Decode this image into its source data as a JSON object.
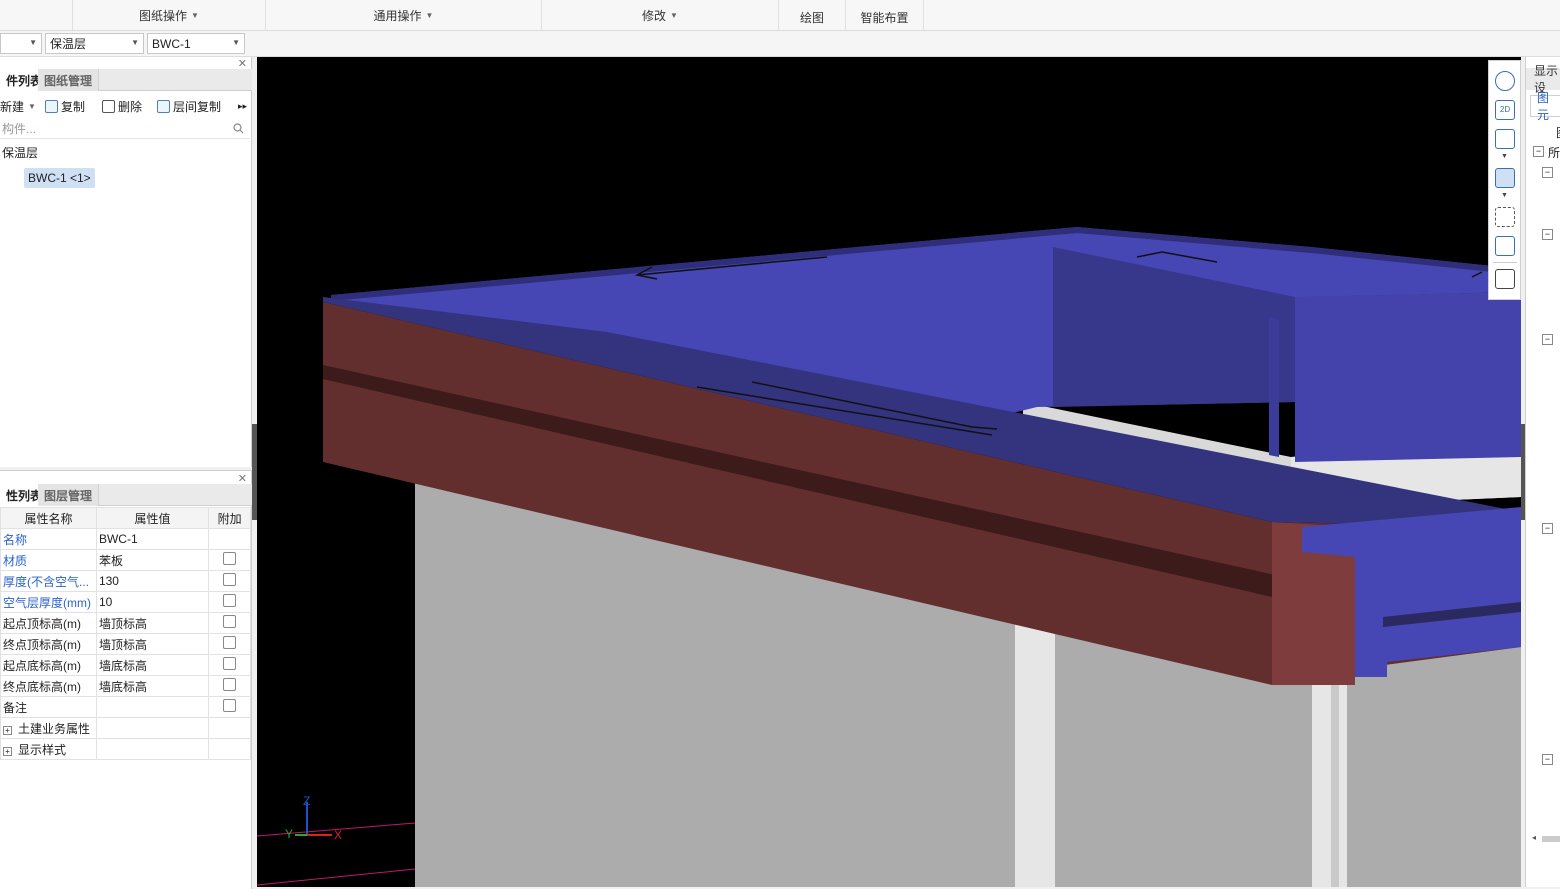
{
  "ribbon": {
    "groups": [
      "图纸操作",
      "通用操作",
      "修改",
      "绘图",
      "智能布置"
    ]
  },
  "selector": {
    "floor": "",
    "type": "保温层",
    "component": "BWC-1"
  },
  "component_list": {
    "tab_active": "件列表",
    "tab_other": "图纸管理",
    "toolbar": {
      "new": "新建",
      "copy": "复制",
      "delete": "删除",
      "floor_copy": "层间复制"
    },
    "search_placeholder": "构件...",
    "tree": {
      "category": "保温层",
      "item": "BWC-1 <1>"
    }
  },
  "property_list": {
    "tab_active": "性列表",
    "tab_other": "图层管理",
    "headers": [
      "属性名称",
      "属性值",
      "附加"
    ],
    "rows": [
      {
        "name": "名称",
        "value": "BWC-1",
        "checkbox": false
      },
      {
        "name": "材质",
        "value": "苯板",
        "checkbox": true
      },
      {
        "name": "厚度(不含空气...",
        "value": "130",
        "checkbox": true
      },
      {
        "name": "空气层厚度(mm)",
        "value": "10",
        "checkbox": true
      },
      {
        "name": "起点顶标高(m)",
        "value": "墙顶标高",
        "checkbox": true
      },
      {
        "name": "终点顶标高(m)",
        "value": "墙顶标高",
        "checkbox": true
      },
      {
        "name": "起点底标高(m)",
        "value": "墙底标高",
        "checkbox": true
      },
      {
        "name": "终点底标高(m)",
        "value": "墙底标高",
        "checkbox": true
      },
      {
        "name": "备注",
        "value": "",
        "checkbox": true
      }
    ],
    "groups": [
      "土建业务属性",
      "显示样式"
    ]
  },
  "view_tools": {
    "labels": [
      "2D"
    ],
    "icons": [
      "orbit-icon",
      "view-2d-icon",
      "box-wire-icon",
      "box-solid-icon",
      "fullscreen-icon",
      "cube-view-icon",
      "display-settings-icon"
    ]
  },
  "axis": {
    "z": "Z",
    "y": "Y",
    "x": "X"
  },
  "right_panel": {
    "tab": "显示设",
    "subtab": "图元",
    "row_label": "图",
    "all_label": "所"
  },
  "colors": {
    "insulation_top": "#4646b4",
    "insulation_dark": "#30307a",
    "wall_brick": "#632e2e",
    "wall_gray": "#acacac",
    "viewport_bg": "#000000"
  }
}
